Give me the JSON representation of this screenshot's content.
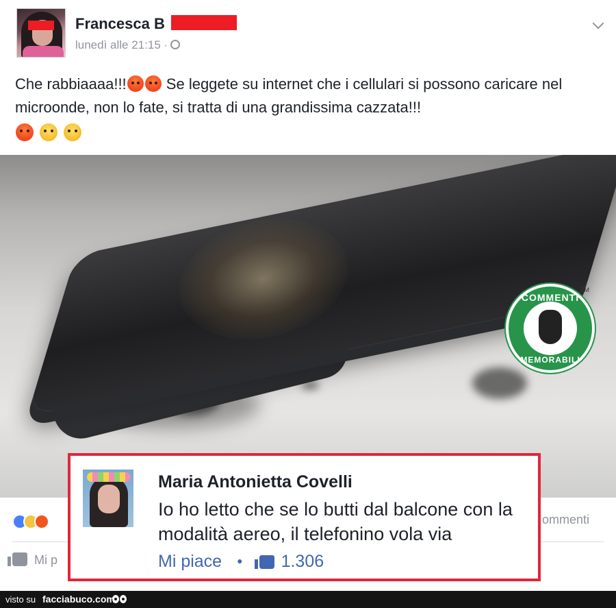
{
  "post": {
    "author": "Francesca B",
    "timestamp": "lunedì alle 21:15 ·",
    "text": "Che rabbiaaaa!!!",
    "text_continuation": "Se leggete su internet che i cellulari si possono caricare nel microonde, non lo fate, si tratta di una grandissima cazzata!!!",
    "inline_emojis": [
      "angry-face-emoji",
      "angry-face-emoji"
    ],
    "trailing_emojis": [
      "angry-face-emoji",
      "steam-face-emoji",
      "steam-face-emoji"
    ]
  },
  "photo": {
    "subject": "burnt-smartphone",
    "logo_text_top": "COMMENTI",
    "logo_text_bottom": "MEMORABILI",
    "logo_mark": "TM",
    "brand_color": "#27944a"
  },
  "reactions": {
    "icons": [
      "like-reaction-icon",
      "sad-reaction-icon",
      "angry-reaction-icon"
    ],
    "comments_partial": "ommenti",
    "like_action_partial": "Mi p"
  },
  "comment": {
    "author": "Maria Antonietta Covelli",
    "text": "Io ho letto che se lo butti dal balcone con la modalità aereo, il telefonino vola via",
    "like_label": "Mi piace",
    "like_count": "1.306",
    "highlight_color": "#e0263b",
    "link_color": "#4267b2"
  },
  "footer": {
    "prefix": "visto su",
    "site": "facciabuco.com"
  }
}
